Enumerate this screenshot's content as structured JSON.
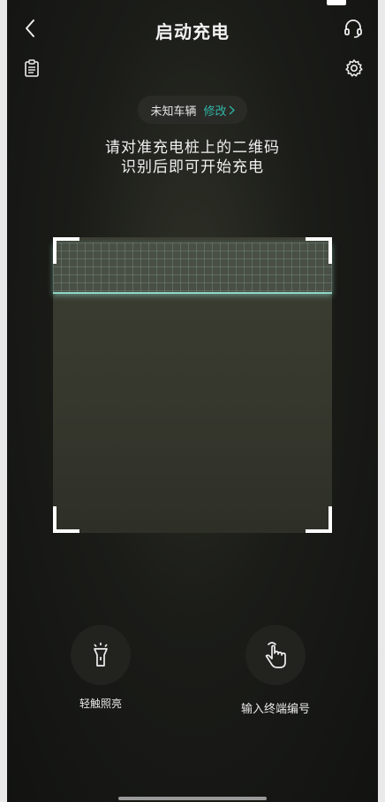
{
  "nav": {
    "title": "启动充电",
    "back_icon": "chevron-left-icon",
    "support_icon": "headset-icon"
  },
  "toolbar": {
    "records_icon": "clipboard-icon",
    "settings_icon": "gear-icon"
  },
  "vehicle": {
    "name": "未知车辆",
    "edit_label": "修改",
    "edit_icon": "chevron-right-icon"
  },
  "instruction": {
    "line1": "请对准充电桩上的二维码",
    "line2": "识别后即可开始充电"
  },
  "actions": {
    "flashlight": {
      "label": "轻触照亮",
      "icon": "flashlight-icon"
    },
    "enter_code": {
      "label": "输入终端编号",
      "icon": "hand-tap-icon"
    }
  },
  "colors": {
    "accent": "#2fb6a6",
    "background": "#1b1c18",
    "scan_line": "#8fd6c6"
  }
}
